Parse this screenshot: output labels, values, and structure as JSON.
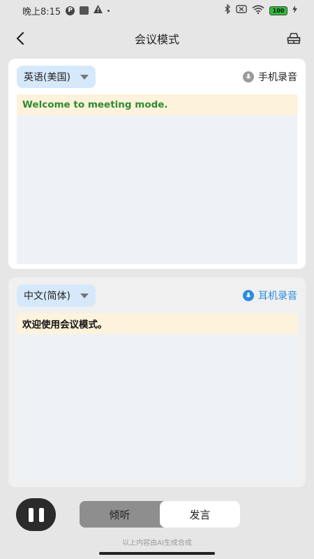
{
  "status_bar": {
    "time": "晚上8:15",
    "battery": "100"
  },
  "header": {
    "title": "会议模式"
  },
  "source_panel": {
    "language": "英语(美国)",
    "mic_label": "手机录音",
    "mic_color": "#9a9a9a",
    "text": "Welcome to meeting mode.",
    "text_color": "#2e8b2e"
  },
  "target_panel": {
    "language": "中文(简体)",
    "mic_label": "耳机录音",
    "mic_color": "#2a8be0",
    "text": "欢迎使用会议模式。",
    "text_color": "#111111"
  },
  "controls": {
    "listen_label": "倾听",
    "speak_label": "发言",
    "active_tab": "speak"
  },
  "footer": {
    "note": "以上内容由AI生成合成"
  }
}
